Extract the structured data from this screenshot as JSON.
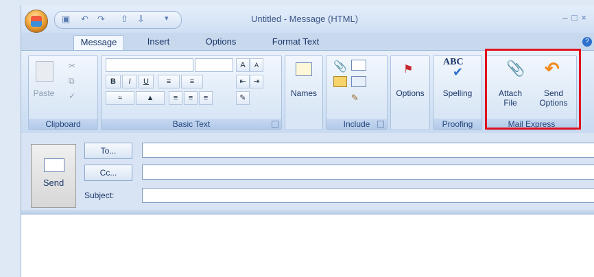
{
  "window": {
    "title": "Untitled - Message (HTML)",
    "help_symbol": "?"
  },
  "tabs": [
    {
      "label": "Message",
      "active": true
    },
    {
      "label": "Insert"
    },
    {
      "label": "Options"
    },
    {
      "label": "Format Text"
    }
  ],
  "ribbon": {
    "clipboard": {
      "group_label": "Clipboard",
      "paste_label": "Paste"
    },
    "basic_text": {
      "group_label": "Basic Text",
      "grow_font": "A",
      "shrink_font": "A",
      "bold": "B",
      "italic": "I",
      "underline": "U"
    },
    "names": {
      "label": "Names"
    },
    "include": {
      "group_label": "Include"
    },
    "options": {
      "label": "Options"
    },
    "proofing": {
      "group_label": "Proofing",
      "spelling_label": "Spelling",
      "abc": "ABC"
    },
    "mail_express": {
      "group_label": "Mail Express",
      "attach_line1": "Attach",
      "attach_line2": "File",
      "send_opt_line1": "Send",
      "send_opt_line2": "Options"
    }
  },
  "header": {
    "send_label": "Send",
    "to_label": "To...",
    "cc_label": "Cc...",
    "subject_label": "Subject:",
    "to_value": "",
    "cc_value": "",
    "subject_value": ""
  },
  "colors": {
    "highlight": "#e0121e",
    "accent": "#2d6fcc"
  }
}
